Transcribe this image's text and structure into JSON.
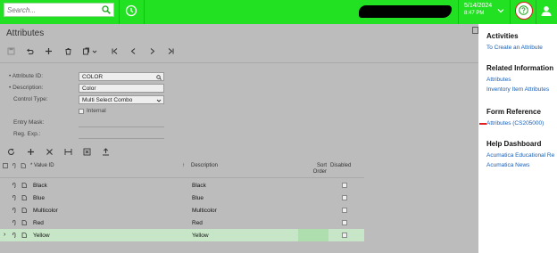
{
  "header": {
    "search_placeholder": "Search...",
    "date": "5/14/2024",
    "time": "8:47 PM",
    "icons": [
      "search-icon",
      "history-icon",
      "chevron-down-icon",
      "help-icon",
      "user-icon"
    ]
  },
  "page": {
    "title": "Attributes"
  },
  "form": {
    "attribute_id_label": "Attribute ID:",
    "attribute_id_value": "COLOR",
    "description_label": "Description:",
    "description_value": "Color",
    "control_type_label": "Control Type:",
    "control_type_value": "Multi Select Combo",
    "internal_label": "Internal",
    "entry_mask_label": "Entry Mask:",
    "reg_exp_label": "Reg. Exp.:"
  },
  "grid": {
    "columns": {
      "value_id": "Value ID",
      "description": "Description",
      "sort_order": "Sort Order",
      "disabled": "Disabled"
    },
    "rows": [
      {
        "value_id": "Black",
        "description": "Black"
      },
      {
        "value_id": "Blue",
        "description": "Blue"
      },
      {
        "value_id": "Multicolor",
        "description": "Multicolor"
      },
      {
        "value_id": "Red",
        "description": "Red"
      },
      {
        "value_id": "Yellow",
        "description": "Yellow"
      }
    ]
  },
  "side_panel": {
    "activities": {
      "title": "Activities",
      "links": [
        "To Create an Attribute"
      ]
    },
    "related": {
      "title": "Related Information",
      "links": [
        "Attributes",
        "Inventory Item Attributes"
      ]
    },
    "form_reference": {
      "title": "Form Reference",
      "link": "Attributes (CS205000)"
    },
    "help": {
      "title": "Help Dashboard",
      "links": [
        "Acumatica Educational Re",
        "Acumatica News"
      ]
    }
  },
  "colors": {
    "topbar": "#22e022",
    "overlay": "#bcbcbc",
    "link": "#1a5fb4",
    "selected_row": "#c7e6c7"
  }
}
